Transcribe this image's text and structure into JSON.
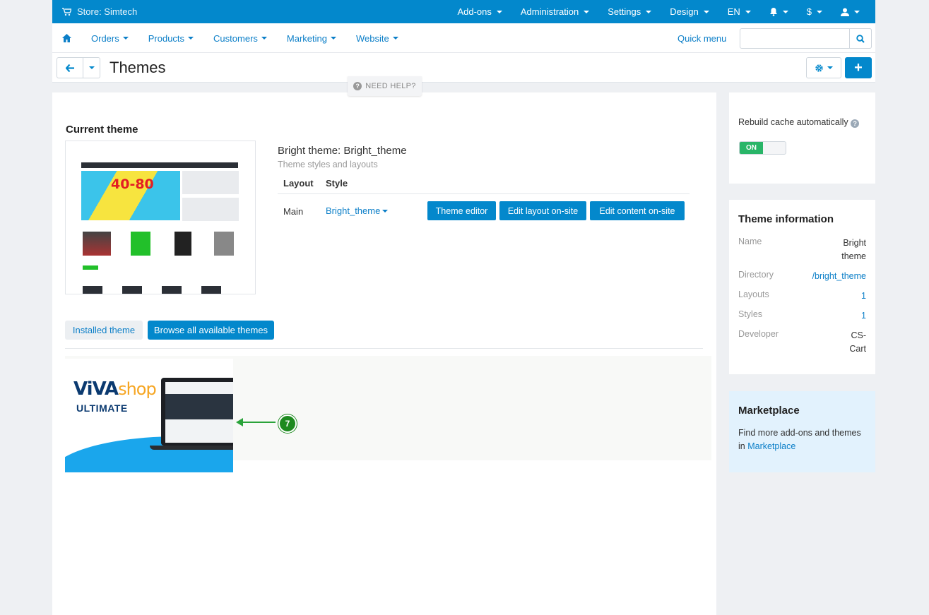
{
  "topbar": {
    "store_label": "Store: Simtech",
    "menus": [
      "Add-ons",
      "Administration",
      "Settings",
      "Design",
      "EN"
    ],
    "currency": "$"
  },
  "nav": {
    "items": [
      "Orders",
      "Products",
      "Customers",
      "Marketing",
      "Website"
    ],
    "quick_menu": "Quick menu",
    "search_placeholder": ""
  },
  "page": {
    "title": "Themes",
    "need_help": "NEED HELP?"
  },
  "current_theme": {
    "heading": "Current theme",
    "thumbnail_sale_text": "40-80",
    "name": "Bright theme: Bright_theme",
    "subtitle": "Theme styles and layouts",
    "table_headers": [
      "Layout",
      "Style"
    ],
    "layout": "Main",
    "style": "Bright_theme",
    "buttons": [
      "Theme editor",
      "Edit layout on-site",
      "Edit content on-site"
    ]
  },
  "tabs": {
    "installed": "Installed theme",
    "browse": "Browse all available themes"
  },
  "marketplace_item": {
    "logo_viva": "ViVA",
    "logo_shop": "shop",
    "subtitle": "ULTIMATE",
    "callout_number": "7"
  },
  "sidebar": {
    "cache_label": "Rebuild cache automatically",
    "cache_toggle": "ON",
    "info_title": "Theme information",
    "info_rows": [
      {
        "key": "Name",
        "value": "Bright theme"
      },
      {
        "key": "Directory",
        "value": "/bright_theme"
      },
      {
        "key": "Layouts",
        "value": "1"
      },
      {
        "key": "Styles",
        "value": "1"
      },
      {
        "key": "Developer",
        "value": "CS-Cart"
      }
    ],
    "market_title": "Marketplace",
    "market_text": "Find more add-ons and themes in",
    "market_link": "Marketplace"
  },
  "colors": {
    "primary": "#0388cc",
    "link": "#0c7fc8",
    "toggle_on": "#29b568",
    "callout": "#1d8a1f"
  }
}
